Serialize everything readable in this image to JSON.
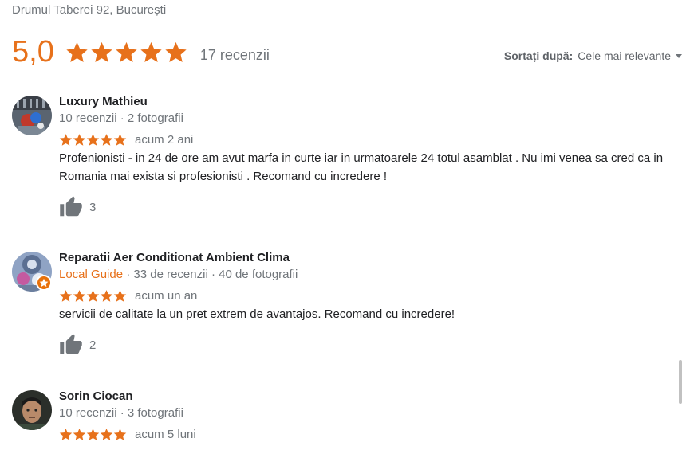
{
  "header": {
    "address": "Drumul Taberei 92, București",
    "rating": "5,0",
    "rating_stars": 5,
    "review_count": "17 recenzii"
  },
  "sort": {
    "label": "Sortați după:",
    "value": "Cele mai relevante"
  },
  "colors": {
    "star": "#e7711b",
    "accent": "#e7711b",
    "muted": "#70757a",
    "text": "#202124"
  },
  "reviews": [
    {
      "name": "Luxury Mathieu",
      "meta": "10 recenzii · 2 fotografii",
      "stars": 5,
      "date": "acum 2 ani",
      "text": "Profenionisti - in 24 de ore am avut marfa in curte iar in urmatoarele 24 totul asamblat . Nu imi venea sa cred ca in Romania mai exista si profesionisti . Recomand cu incredere !",
      "likes": "3"
    },
    {
      "name": "Reparatii Aer Conditionat Ambient Clima",
      "guide": "Local Guide",
      "meta": " · 33 de recenzii · 40 de fotografii",
      "stars": 5,
      "date": "acum un an",
      "text": "servicii de calitate la un pret extrem de avantajos. Recomand cu incredere!",
      "likes": "2"
    },
    {
      "name": "Sorin Ciocan",
      "meta": "10 recenzii · 3 fotografii",
      "stars": 5,
      "date": "acum 5 luni"
    }
  ]
}
